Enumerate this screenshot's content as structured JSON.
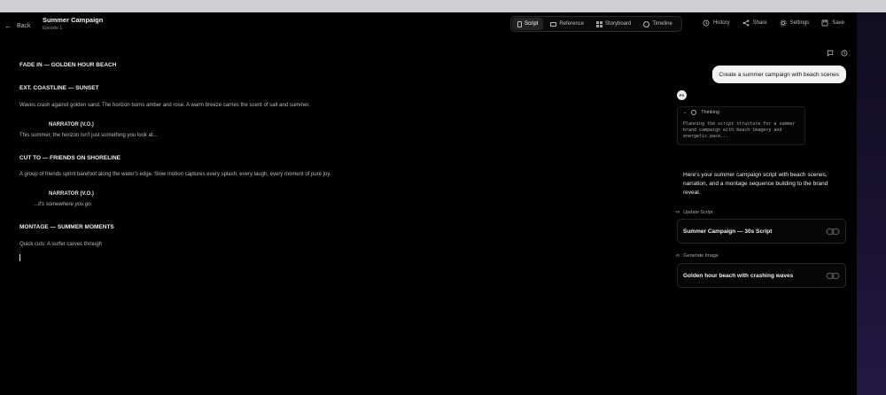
{
  "header": {
    "back_label": "Back",
    "project_title": "Summer Campaign",
    "episode": "Episode 1",
    "tabs": [
      {
        "label": "Script",
        "icon": "document-icon",
        "active": true
      },
      {
        "label": "Reference",
        "icon": "folder-icon",
        "active": false
      },
      {
        "label": "Storyboard",
        "icon": "grid-icon",
        "active": false
      },
      {
        "label": "Timeline",
        "icon": "clock-icon",
        "active": false
      }
    ],
    "actions": [
      {
        "label": "History",
        "icon": "history-icon"
      },
      {
        "label": "Share",
        "icon": "share-icon"
      },
      {
        "label": "Settings",
        "icon": "gear-icon"
      },
      {
        "label": "Save",
        "icon": "save-icon"
      }
    ]
  },
  "script": {
    "lines": {
      "s1": "FADE IN — GOLDEN HOUR BEACH",
      "s2": "EXT. COASTLINE — SUNSET",
      "a1": "Waves crash against golden sand. The horizon burns amber and rose. A warm breeze carries the scent of salt and summer.",
      "c1": "NARRATOR (V.O.)",
      "d1": "This summer, the horizon isn't just something you look at...",
      "s3": "CUT TO — FRIENDS ON SHORELINE",
      "a2": "A group of friends sprint barefoot along the water's edge. Slow motion captures every splash, every laugh, every moment of pure joy.",
      "c2": "NARRATOR (V.O.)",
      "d2": "...it's somewhere you go.",
      "s4": "MONTAGE — SUMMER MOMENTS",
      "a3": "Quick cuts: A surfer carves through"
    }
  },
  "panel": {
    "user_message": "Create a summer campaign with beach scenes",
    "avatar_initials": "PX",
    "thinking_label": "Thinking",
    "thinking_text": "Planning the script structure for a summer brand campaign with beach imagery and energetic pace...",
    "assistant_text": "Here's your summer campaign script with beach scenes, narration, and a montage sequence building to the brand reveal.",
    "tools": [
      {
        "label": "Update Script",
        "card_title": "Summer Campaign — 30s Script"
      },
      {
        "label": "Generate Image",
        "card_title": "Golden hour beach with crashing waves"
      }
    ]
  },
  "colors": {
    "background": "#000000",
    "user_bubble": "#f2f2f2",
    "accent_edge": "#241845"
  }
}
